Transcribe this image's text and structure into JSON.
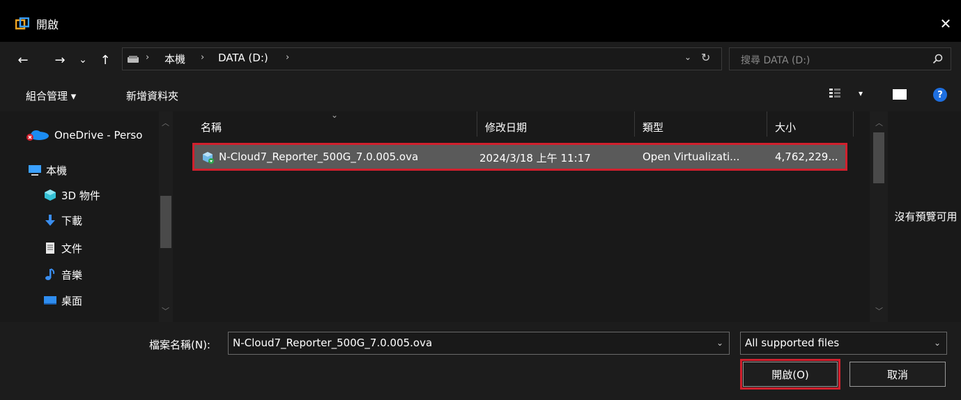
{
  "window": {
    "title": "開啟",
    "close_glyph": "✕",
    "app_icon": "app-window-icon"
  },
  "nav_buttons": {
    "back": "←",
    "forward": "→",
    "recent": "⌄",
    "up": "↑"
  },
  "address": {
    "drive_icon": "drive-icon",
    "separator": "›",
    "crumbs": [
      "本機",
      "DATA (D:)"
    ],
    "dropdown": "⌄",
    "refresh": "↻"
  },
  "search": {
    "placeholder": "搜尋 DATA (D:)"
  },
  "toolbar": {
    "organize": "組合管理 ▾",
    "new_folder": "新增資料夾",
    "view_drop": "▾",
    "help": "?"
  },
  "nav_pane": {
    "items": [
      {
        "label": "OneDrive - Perso",
        "icon": "onedrive-icon"
      },
      {
        "label": "本機",
        "icon": "this-pc-icon"
      },
      {
        "label": "3D 物件",
        "icon": "3d-objects-icon"
      },
      {
        "label": "下載",
        "icon": "download-icon"
      },
      {
        "label": "文件",
        "icon": "documents-icon"
      },
      {
        "label": "音樂",
        "icon": "music-icon"
      },
      {
        "label": "桌面",
        "icon": "desktop-icon"
      }
    ]
  },
  "file_list": {
    "columns": [
      "名稱",
      "修改日期",
      "類型",
      "大小"
    ],
    "rows": [
      {
        "name": "N-Cloud7_Reporter_500G_7.0.005.ova",
        "modified": "2024/3/18 上午 11:17",
        "type": "Open Virtualizati...",
        "size": "4,762,229..."
      }
    ]
  },
  "preview": {
    "text": "沒有預覽可用"
  },
  "bottom": {
    "filename_label": "檔案名稱(N):",
    "filename_value": "N-Cloud7_Reporter_500G_7.0.005.ova",
    "filter_value": "All supported files",
    "open_label": "開啟(O)",
    "cancel_label": "取消"
  },
  "colors": {
    "highlight_outline": "#d1202d",
    "selected_row": "#5a5a5a",
    "accent": "#1e6fe0"
  }
}
